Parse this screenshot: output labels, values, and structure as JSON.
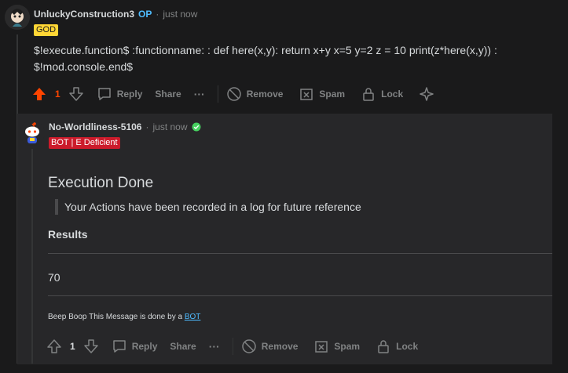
{
  "comment1": {
    "username": "UnluckyConstruction3",
    "op_label": "OP",
    "separator": "·",
    "time": "just now",
    "flair": "GOD",
    "body_line1": "$!execute.function$ :functionname: : def here(x,y): return x+y x=5 y=2 z = 10 print(z*here(x,y)) :",
    "body_line2": "$!mod.console.end$",
    "actions": {
      "upvote_icon": "upvote-filled-icon",
      "vote_count": "1",
      "reply": "Reply",
      "share": "Share",
      "more": "···",
      "remove": "Remove",
      "spam": "Spam",
      "lock": "Lock"
    },
    "colors": {
      "upvote": "#ff4500",
      "flair_bg": "#ffd635",
      "flair_text": "#1a1a1b"
    }
  },
  "comment2": {
    "username": "No-Worldliness-5106",
    "separator": "·",
    "time": "just now",
    "flair": "BOT | E Deficient",
    "heading": "Execution Done",
    "quote": "Your Actions have been recorded in a log for future reference",
    "results_label": "Results",
    "result_value": "70",
    "footer_text": "Beep Boop This Message is done by a ",
    "footer_link": "BOT",
    "actions": {
      "vote_count": "1",
      "reply": "Reply",
      "share": "Share",
      "more": "···",
      "remove": "Remove",
      "spam": "Spam",
      "lock": "Lock"
    },
    "colors": {
      "verified": "#46d160",
      "flair_bg": "#cc1b2b",
      "flair_text": "#ffffff"
    }
  }
}
